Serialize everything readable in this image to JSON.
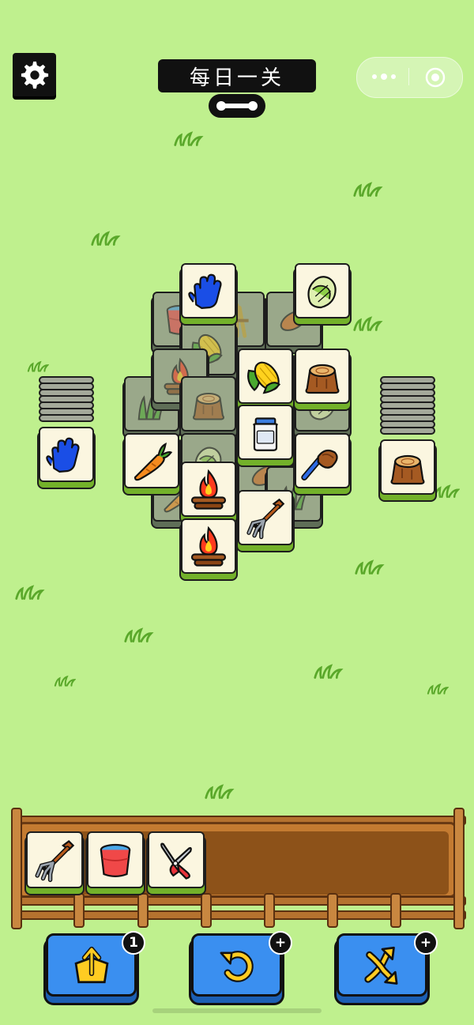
{
  "header": {
    "title": "每日一关"
  },
  "tiles": [
    {
      "id": "t01",
      "icon": "bucket-icon",
      "state": "covered"
    },
    {
      "id": "t02",
      "icon": "wheat-icon",
      "state": "covered"
    },
    {
      "id": "t03",
      "icon": "sweet-potato-icon",
      "state": "covered"
    },
    {
      "id": "t04",
      "icon": "glove-icon",
      "state": "free"
    },
    {
      "id": "t05",
      "icon": "cabbage-icon",
      "state": "free"
    },
    {
      "id": "t06",
      "icon": "campfire-icon",
      "state": "covered"
    },
    {
      "id": "t07",
      "icon": "corn-icon",
      "state": "free"
    },
    {
      "id": "t08",
      "icon": "stump-icon",
      "state": "free"
    },
    {
      "id": "t09",
      "icon": "grass-icon",
      "state": "covered"
    },
    {
      "id": "t10",
      "icon": "stump-icon",
      "state": "covered"
    },
    {
      "id": "t11",
      "icon": "milk-jar-icon",
      "state": "free"
    },
    {
      "id": "t12",
      "icon": "carrot-icon",
      "state": "free"
    },
    {
      "id": "t13",
      "icon": "brush-icon",
      "state": "free"
    },
    {
      "id": "t14",
      "icon": "campfire-icon",
      "state": "free"
    },
    {
      "id": "t15",
      "icon": "pitchfork-icon",
      "state": "free"
    },
    {
      "id": "t16",
      "icon": "campfire-icon",
      "state": "free"
    }
  ],
  "side_stacks": {
    "left_top_icon": "glove-icon",
    "right_top_icon": "stump-icon"
  },
  "tray": {
    "slots": [
      "pitchfork-icon",
      "water-bucket-icon",
      "pruning-shears-icon"
    ]
  },
  "actions": [
    {
      "id": "move-out",
      "icon": "move-out-icon",
      "badge": "1"
    },
    {
      "id": "undo",
      "icon": "undo-icon",
      "badge": "+"
    },
    {
      "id": "shuffle",
      "icon": "shuffle-icon",
      "badge": "+"
    }
  ],
  "colors": {
    "background": "#bff08e",
    "tile_face": "#fbf6e0",
    "tile_base": "#73b12a",
    "button_blue": "#3a8ff0"
  }
}
